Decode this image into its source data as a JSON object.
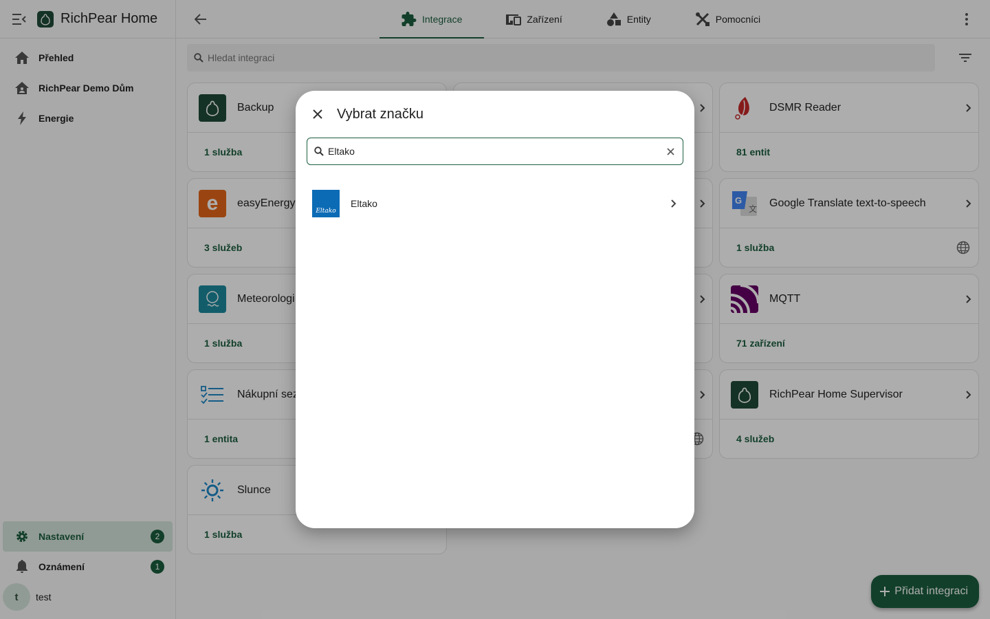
{
  "app": {
    "title": "RichPear Home"
  },
  "sidebar": {
    "items": [
      {
        "label": "Přehled",
        "icon": "home-icon"
      },
      {
        "label": "RichPear Demo Dům",
        "icon": "home-account-icon"
      },
      {
        "label": "Energie",
        "icon": "lightning-icon"
      }
    ],
    "settings": {
      "label": "Nastavení",
      "badge": "2"
    },
    "notifications": {
      "label": "Oznámení",
      "badge": "1"
    },
    "user": {
      "initial": "t",
      "name": "test"
    }
  },
  "tabs": [
    {
      "label": "Integrace",
      "active": true
    },
    {
      "label": "Zařízení",
      "active": false
    },
    {
      "label": "Entity",
      "active": false
    },
    {
      "label": "Pomocníci",
      "active": false
    }
  ],
  "search": {
    "placeholder": "Hledat integraci"
  },
  "cards": [
    {
      "name": "Backup",
      "footer": "1 služba"
    },
    {
      "name": "DSMR Reader",
      "footer": "81 entit"
    },
    {
      "name": "easyEnergy",
      "footer": "3 služeb"
    },
    {
      "name": "Google Translate text-to-speech",
      "footer": "1 služba"
    },
    {
      "name": "Meteorologi",
      "footer": "1 služba"
    },
    {
      "name": "MQTT",
      "footer": "71 zařízení"
    },
    {
      "name": "Nákupní sez",
      "footer": "1 entita"
    },
    {
      "name": "RichPear Home Supervisor",
      "footer": "4 služeb"
    },
    {
      "name": "Slunce",
      "footer": "1 služba"
    }
  ],
  "fab": {
    "label": "Přidat integraci"
  },
  "dialog": {
    "title": "Vybrat značku",
    "search_value": "Eltako",
    "results": [
      {
        "name": "Eltako",
        "logo_text": "Eltako"
      }
    ]
  },
  "colors": {
    "primary": "#1b5e3f",
    "active_bg": "#d6e5dc",
    "eltako_blue": "#0c6bb5"
  }
}
